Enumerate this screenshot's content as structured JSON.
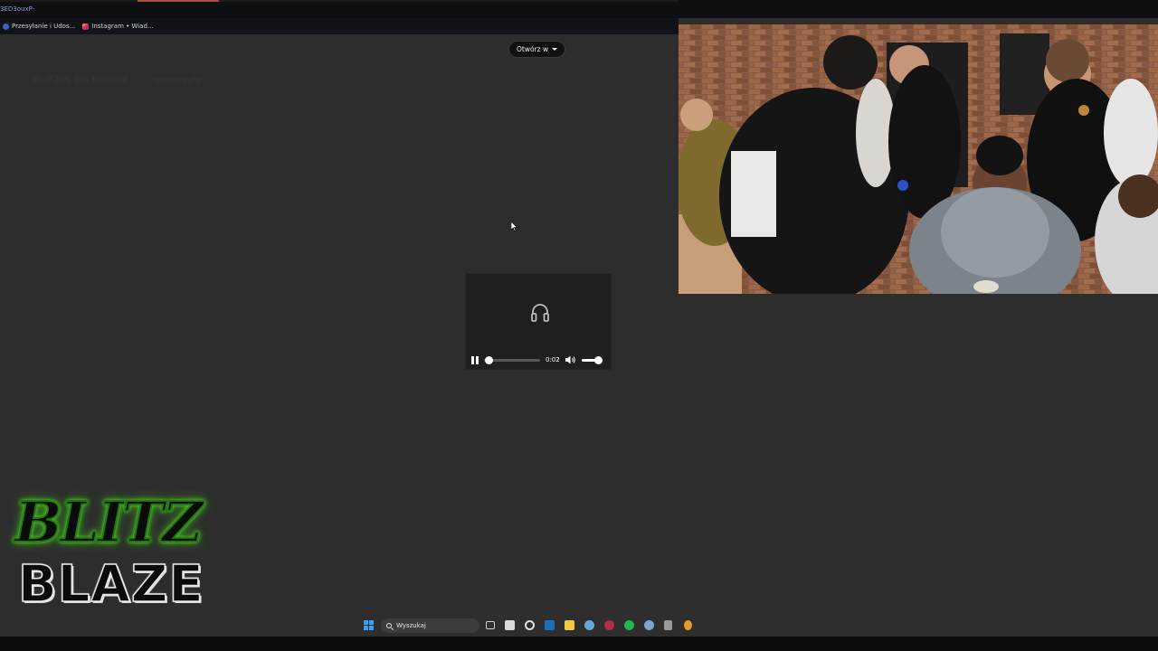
{
  "browser": {
    "url_fragment": "3ED3ouxP-",
    "bookmarks": [
      {
        "label": "Przesyłanie i Udos...",
        "icon": "facebook-icon"
      },
      {
        "label": "Instagram • Wiad...",
        "icon": "instagram-icon"
      }
    ],
    "ghost_text": [
      "BLITZIN DA BOOTH",
      "otworzyły"
    ]
  },
  "open_in": {
    "label": "Otwórz w"
  },
  "audio_player": {
    "icon": "headphones-icon",
    "time": "0:02",
    "progress_fraction": 0.02,
    "volume_fraction": 1.0
  },
  "overlay": {
    "logo_line1": "BLITZ",
    "logo_line2": "BLAZE",
    "logo_colors": {
      "glow": "#52d61f",
      "fill": "#0b0b0b"
    }
  },
  "taskbar": {
    "search_placeholder": "Wyszukaj",
    "start_color": "#3aa0f2"
  }
}
